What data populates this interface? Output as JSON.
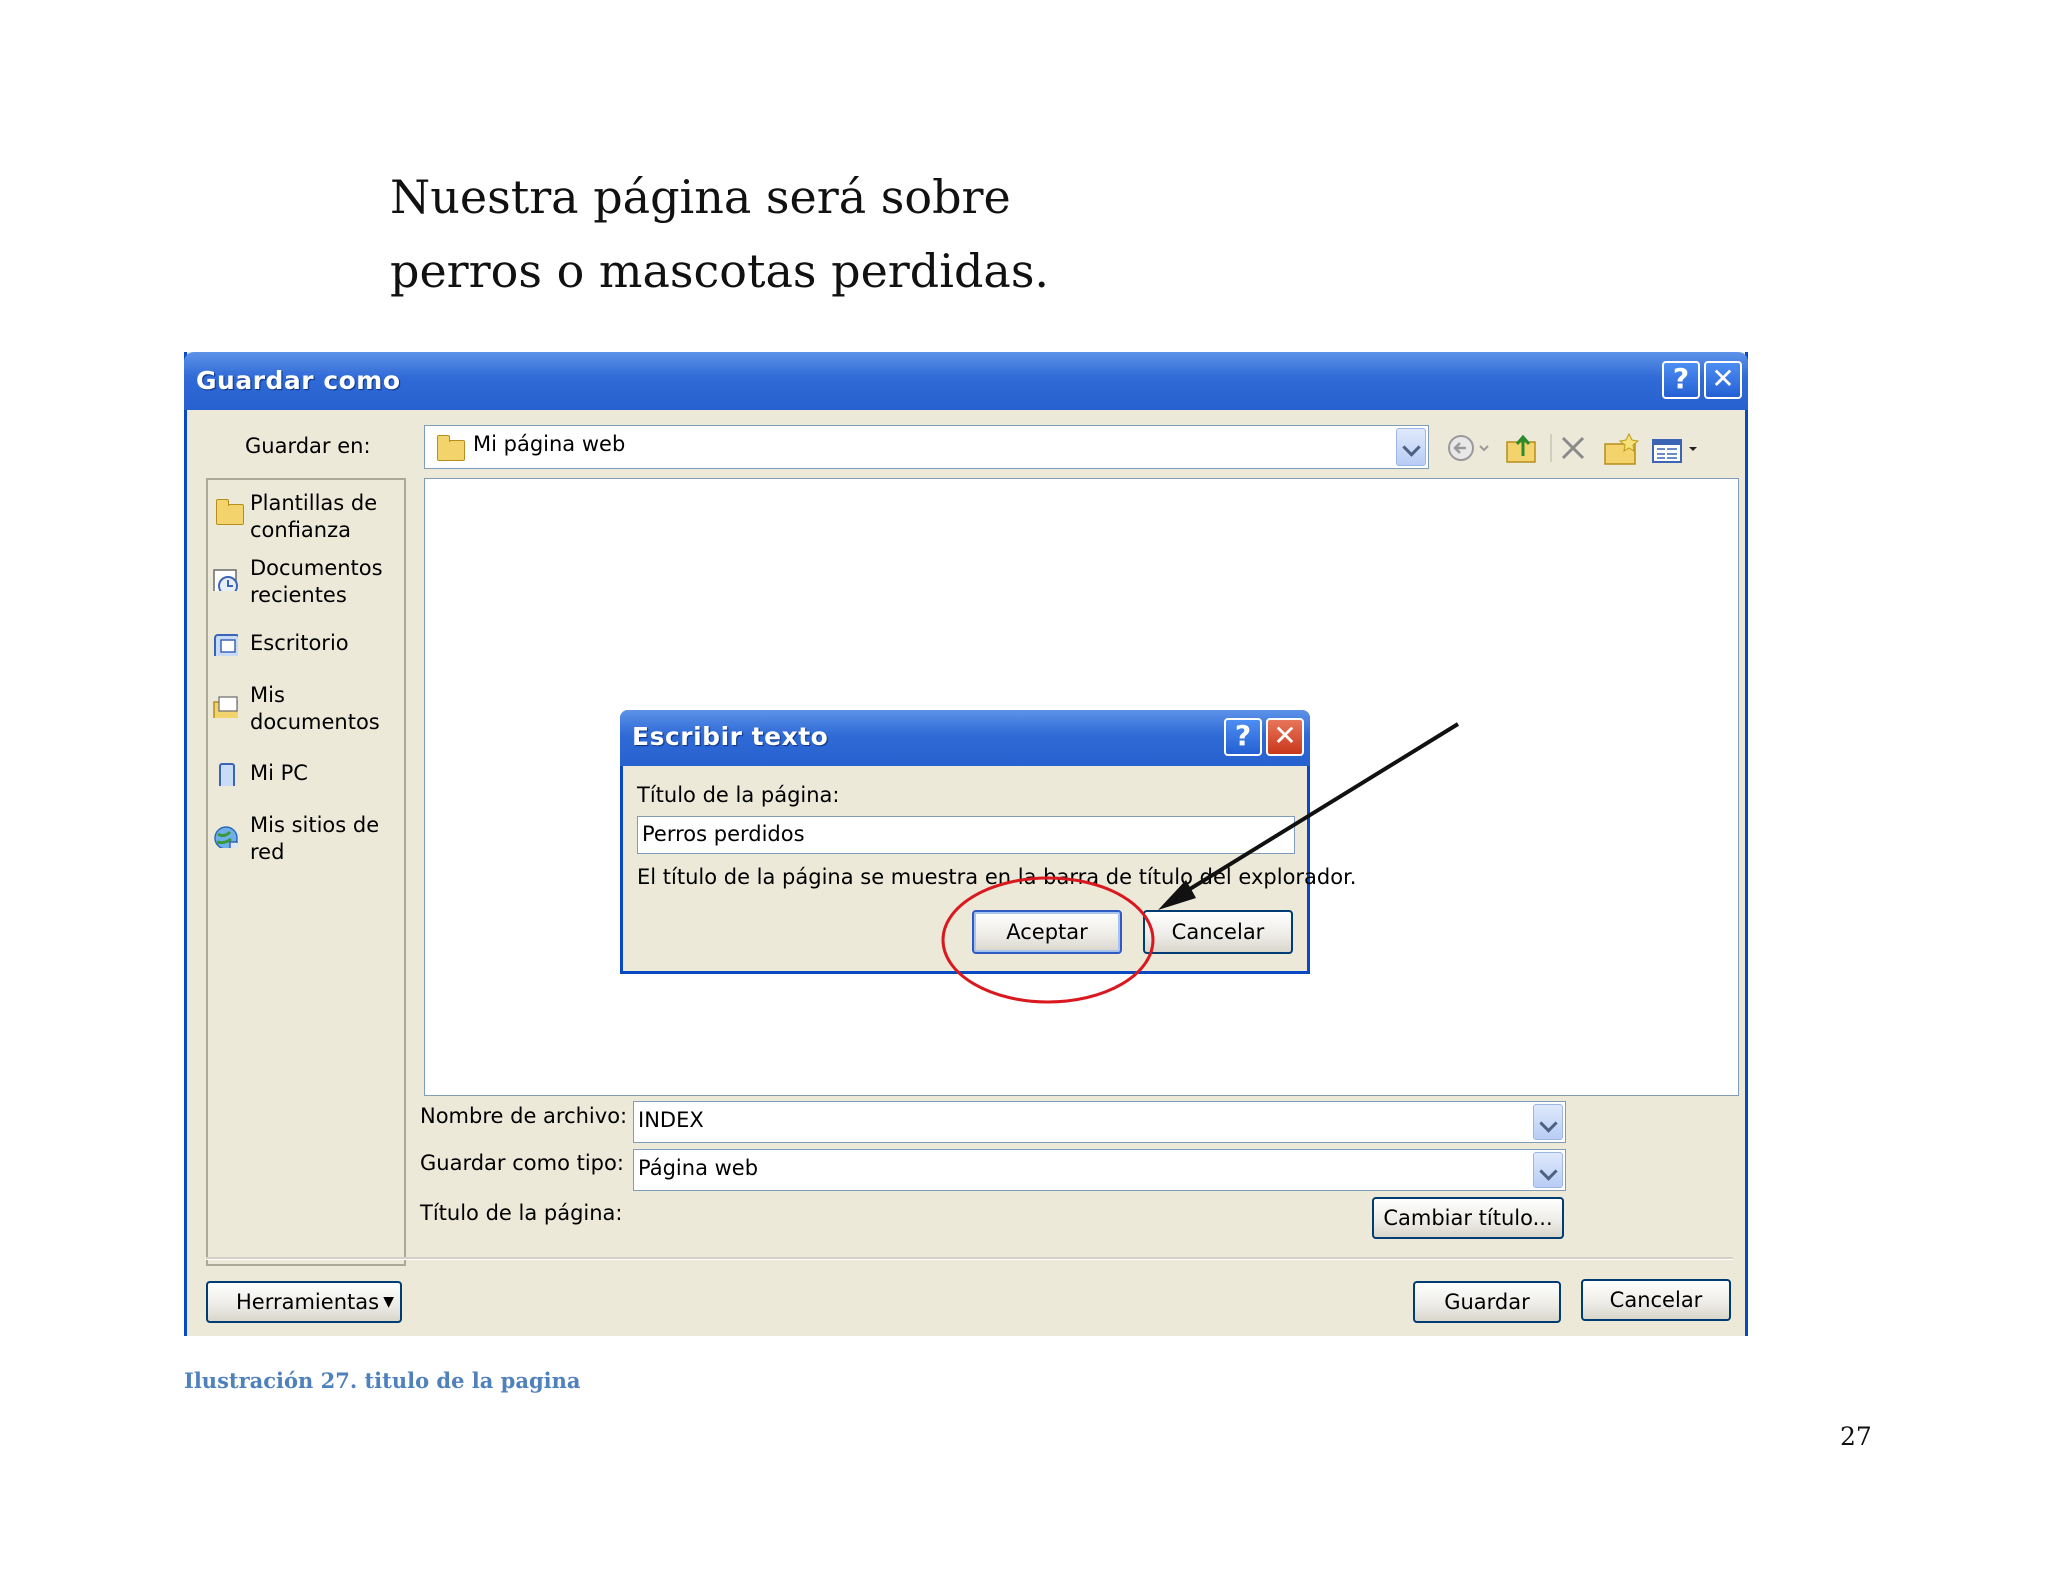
{
  "intro": {
    "line1": "Nuestra página será sobre",
    "line2": "perros o mascotas perdidas."
  },
  "save_dialog": {
    "title": "Guardar como",
    "help_glyph": "?",
    "close_glyph": "✕",
    "save_in_label": "Guardar en:",
    "save_in_value": "Mi página web",
    "places": [
      {
        "label": "Plantillas de\nconfianza",
        "icon": "folder-icon"
      },
      {
        "label": "Documentos\nrecientes",
        "icon": "recent-documents-icon"
      },
      {
        "label": "Escritorio",
        "icon": "desktop-icon"
      },
      {
        "label": "Mis\ndocumentos",
        "icon": "my-documents-icon"
      },
      {
        "label": "Mi PC",
        "icon": "my-computer-icon"
      },
      {
        "label": "Mis sitios de\nred",
        "icon": "network-places-icon"
      }
    ],
    "toolbar_icons": [
      "back-icon",
      "up-folder-icon",
      "delete-icon",
      "new-folder-icon",
      "views-icon"
    ],
    "filename_label": "Nombre de archivo:",
    "filename_value": "INDEX",
    "save_type_label": "Guardar como tipo:",
    "save_type_value": "Página web",
    "page_title_label": "Título de la página:",
    "change_title_button": "Cambiar título...",
    "tools_button": "Herramientas",
    "save_button": "Guardar",
    "cancel_button": "Cancelar"
  },
  "text_dialog": {
    "title": "Escribir texto",
    "field_label": "Título de la página:",
    "field_value": "Perros perdidos",
    "hint": "El título de la página se muestra en la barra de título del explorador.",
    "ok_button": "Aceptar",
    "cancel_button": "Cancelar"
  },
  "annotation": {
    "circle_color": "#d9191f",
    "arrow_color": "#111111"
  },
  "caption": "Ilustración 27. titulo de la pagina",
  "page_number": "27"
}
